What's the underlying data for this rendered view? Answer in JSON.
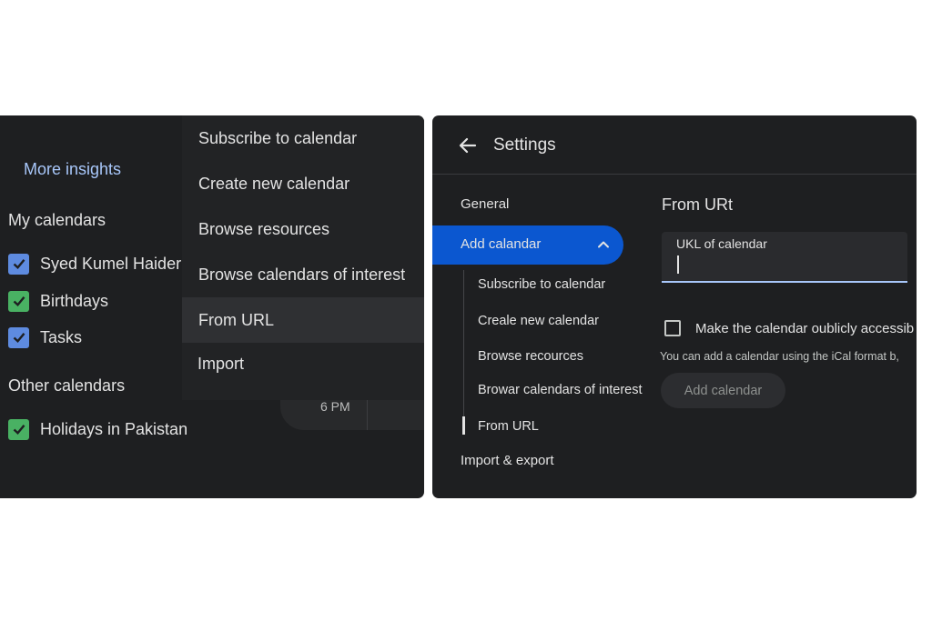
{
  "left_panel": {
    "more_insights": "More insights",
    "my_calendars_title": "My calendars",
    "my_calendars": [
      {
        "label": "Syed Kumel Haider",
        "color": "#5e8be0"
      },
      {
        "label": "Birthdays",
        "color": "#49b163"
      },
      {
        "label": "Tasks",
        "color": "#5e8be0"
      }
    ],
    "other_calendars_title": "Other calendars",
    "other_calendars": [
      {
        "label": "Holidays in Pakistan",
        "color": "#49b163"
      }
    ],
    "time_label": "6 PM",
    "menu": {
      "items": [
        "Subscribe to calendar",
        "Create new calendar",
        "Browse resources",
        "Browse calendars of interest",
        "From URL",
        "Import"
      ],
      "highlighted": "From URL"
    }
  },
  "right_panel": {
    "title": "Settings",
    "nav": {
      "general": "General",
      "add_calendar": "Add calandar",
      "sub_items": [
        "Subscribe to calendar",
        "Creale new calendar",
        "Browse recources",
        "Browar calendars of interest",
        "From URL"
      ],
      "import_export": "Import & export"
    },
    "section_heading": "From URt",
    "url_field": {
      "label": "UKL of calendar",
      "value": ""
    },
    "public_checkbox_label": "Make the calendar oublicly accessib",
    "public_checked": false,
    "helper_text": "You can add a calendar using the iCal format b,",
    "add_button": "Add calendar"
  },
  "colors": {
    "panel_bg": "#1e1f21",
    "menu_bg": "#222325",
    "accent_blue": "#0b57d0",
    "link_blue": "#a8c7fa",
    "text": "#e3e3e3"
  }
}
